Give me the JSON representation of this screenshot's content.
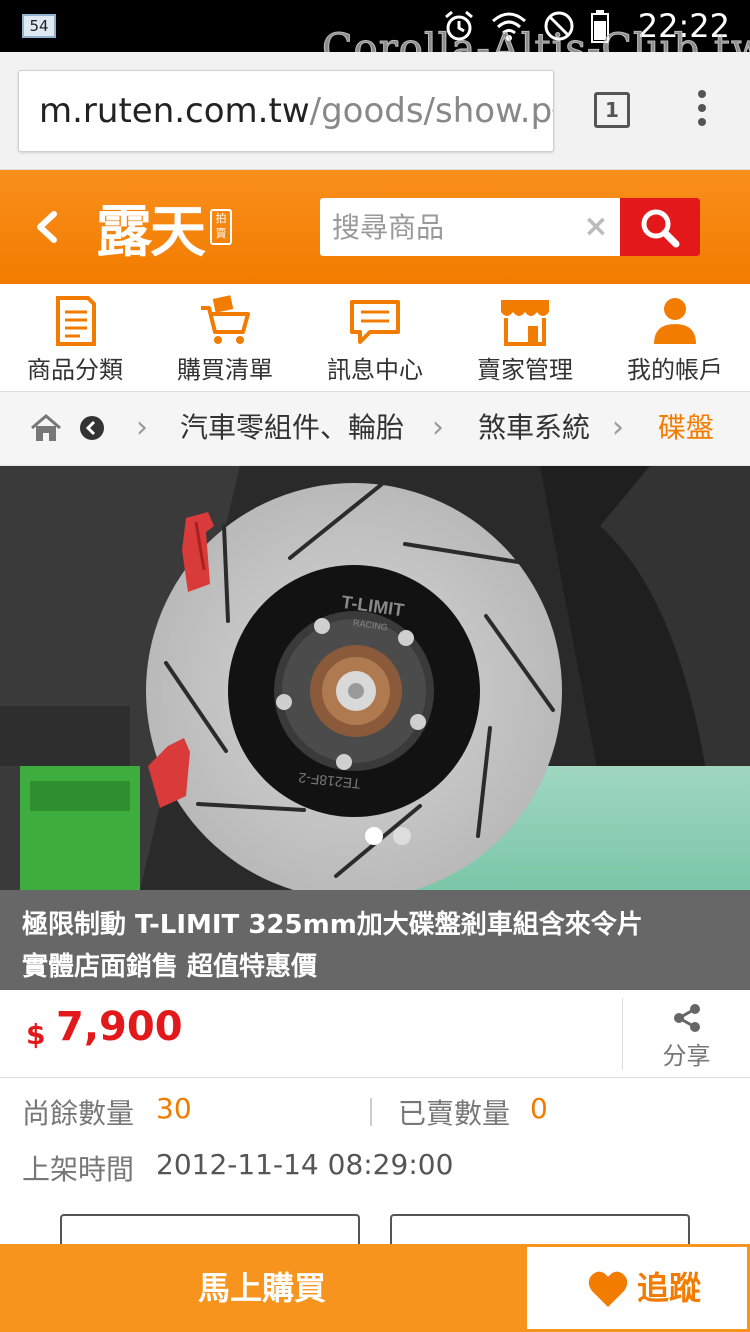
{
  "status_bar": {
    "notification_badge": "54",
    "time": "22:22",
    "watermark": "Corolla-Altis-Club.tw",
    "icons": [
      "alarm-icon",
      "wifi-icon",
      "do-not-disturb-icon",
      "battery-icon"
    ]
  },
  "browser": {
    "url_host": "m.ruten.com.tw",
    "url_path": "/goods/show.pł",
    "tab_count": "1"
  },
  "header": {
    "logo_text": "露天",
    "logo_tag": "拍賣",
    "search_placeholder": "搜尋商品",
    "clear_symbol": "×",
    "colors": {
      "brand": "#f27c00",
      "search_button": "#e3181a"
    }
  },
  "nav": {
    "items": [
      {
        "label": "商品分類",
        "icon": "category-icon"
      },
      {
        "label": "購買清單",
        "icon": "cart-icon"
      },
      {
        "label": "訊息中心",
        "icon": "message-icon"
      },
      {
        "label": "賣家管理",
        "icon": "store-icon"
      },
      {
        "label": "我的帳戶",
        "icon": "user-icon"
      }
    ]
  },
  "breadcrumb": {
    "items": [
      "汽車零組件、輪胎",
      "煞車系統",
      "碟盤"
    ],
    "separator": "›"
  },
  "product": {
    "title_line1": "極限制動 T-LIMIT 325mm加大碟盤剎車組含來令片",
    "title_line2": "實體店面銷售 超值特惠價",
    "rotor_brand": "T-LIMIT",
    "rotor_sub": "RACING",
    "rotor_code": "TE218F-2",
    "image_count": 2,
    "active_image": 1,
    "price_currency": "$",
    "price": "7,900",
    "share_label": "分享",
    "remaining_label": "尚餘數量",
    "remaining_value": "30",
    "sold_label": "已賣數量",
    "sold_value": "0",
    "listed_label": "上架時間",
    "listed_value": "2012-11-14 08:29:00"
  },
  "actions": {
    "buy_label": "馬上購買",
    "track_label": "追蹤"
  }
}
